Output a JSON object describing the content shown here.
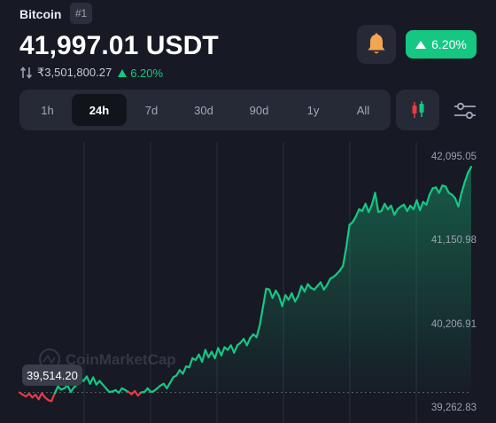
{
  "coin": {
    "name": "Bitcoin",
    "rank": "#1"
  },
  "price": {
    "main": "41,997.01 USDT",
    "inr": "₹3,501,800.27",
    "change_pct": "6.20%"
  },
  "alert": {
    "icon": "bell-icon"
  },
  "change_pill": {
    "label": "6.20%",
    "color": "#16c784"
  },
  "ranges": [
    {
      "label": "1h",
      "active": false
    },
    {
      "label": "24h",
      "active": true
    },
    {
      "label": "7d",
      "active": false
    },
    {
      "label": "30d",
      "active": false
    },
    {
      "label": "90d",
      "active": false
    },
    {
      "label": "1y",
      "active": false
    },
    {
      "label": "All",
      "active": false
    }
  ],
  "toolbar": {
    "candle_icon": "candlestick-icon",
    "settings_icon": "sliders-icon"
  },
  "chart_labels": {
    "y_ticks": [
      "42,095.05",
      "41,150.98",
      "40,206.91",
      "39,262.83"
    ],
    "watermark": "CoinMarketCap",
    "start_price": "39,514.20"
  },
  "chart_data": {
    "type": "line",
    "ylim": [
      39180,
      42180
    ],
    "y_ticks": [
      42095.05,
      41150.98,
      40206.91,
      39262.83
    ],
    "baseline": 39514.2,
    "colors": {
      "up": "#16c784",
      "down": "#ea3943"
    },
    "grid": "vertical",
    "series": [
      {
        "values": [
          39515,
          39490,
          39470,
          39500,
          39460,
          39490,
          39440,
          39505,
          39460,
          39430,
          39420,
          39505,
          39580,
          39545,
          39560,
          39590,
          39520,
          39570,
          39600,
          39660,
          39640,
          39690,
          39610,
          39680,
          39600,
          39640,
          39600,
          39560,
          39520,
          39525,
          39540,
          39510,
          39560,
          39540,
          39520,
          39495,
          39530,
          39480,
          39515,
          39520,
          39560,
          39520,
          39530,
          39560,
          39590,
          39610,
          39560,
          39620,
          39680,
          39700,
          39760,
          39720,
          39800,
          39790,
          39890,
          39870,
          39930,
          39850,
          39980,
          39900,
          39960,
          39890,
          40000,
          39920,
          40010,
          39980,
          40030,
          39950,
          40030,
          40060,
          40100,
          40030,
          40110,
          40150,
          40120,
          40250,
          40450,
          40650,
          40640,
          40550,
          40630,
          40570,
          40460,
          40580,
          40530,
          40600,
          40510,
          40570,
          40680,
          40620,
          40700,
          40660,
          40640,
          40680,
          40720,
          40640,
          40690,
          40760,
          40780,
          40810,
          40850,
          40900,
          41100,
          41350,
          41380,
          41440,
          41520,
          41500,
          41580,
          41490,
          41570,
          41700,
          41490,
          41500,
          41580,
          41520,
          41560,
          41460,
          41520,
          41550,
          41570,
          41500,
          41560,
          41520,
          41620,
          41510,
          41600,
          41570,
          41680,
          41750,
          41760,
          41700,
          41780,
          41770,
          41700,
          41680,
          41640,
          41550,
          41700,
          41820,
          41920,
          41985
        ]
      }
    ]
  }
}
